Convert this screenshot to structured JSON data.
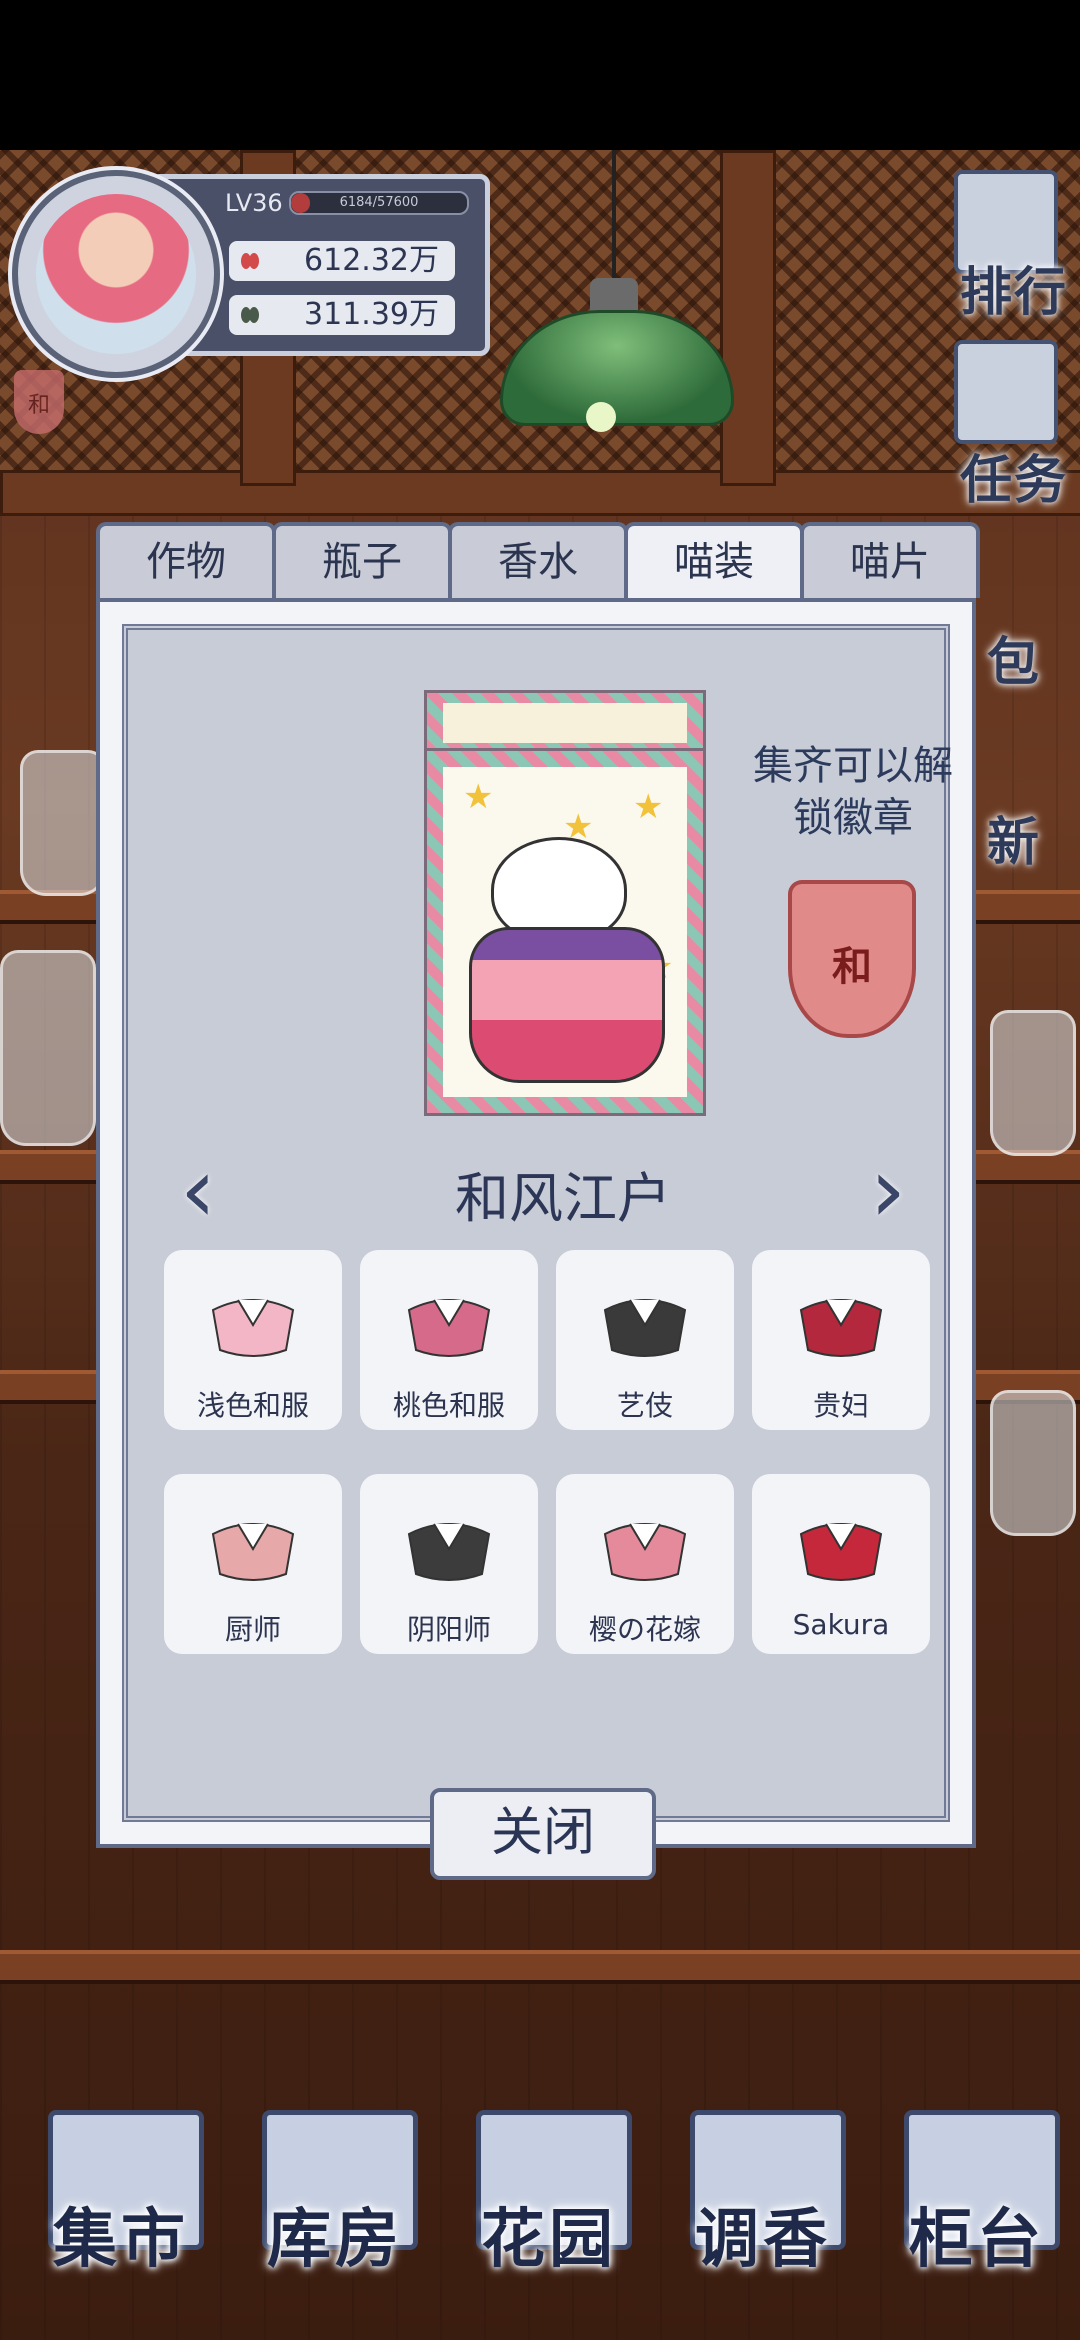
{
  "player": {
    "level": "LV36",
    "xp": "6184/57600",
    "xp_progress": 0.107,
    "coins_red": "612.32万",
    "coins_green": "311.39万"
  },
  "small_badge": "和",
  "side_buttons": [
    "排行",
    "任务",
    "包",
    "新"
  ],
  "tabs": [
    {
      "label": "作物",
      "active": false
    },
    {
      "label": "瓶子",
      "active": false
    },
    {
      "label": "香水",
      "active": false
    },
    {
      "label": "喵装",
      "active": true
    },
    {
      "label": "喵片",
      "active": false
    }
  ],
  "collection": {
    "hint": "集齐可以解锁徽章",
    "badge_char": "和",
    "set_title": "和风江户",
    "prev_arrow": "‹",
    "next_arrow": "›"
  },
  "outfits": [
    {
      "label": "浅色和服"
    },
    {
      "label": "桃色和服"
    },
    {
      "label": "艺伎"
    },
    {
      "label": "贵妇"
    },
    {
      "label": "厨师"
    },
    {
      "label": "阴阳师"
    },
    {
      "label": "樱の花嫁"
    },
    {
      "label": "Sakura"
    }
  ],
  "close_label": "关闭",
  "bottom_nav": [
    {
      "label": "集市"
    },
    {
      "label": "库房"
    },
    {
      "label": "花园"
    },
    {
      "label": "调香"
    },
    {
      "label": "柜台"
    }
  ],
  "colors": {
    "accent": "#2c3656",
    "panel": "#c8ccd7",
    "wood": "#6a3a22"
  }
}
